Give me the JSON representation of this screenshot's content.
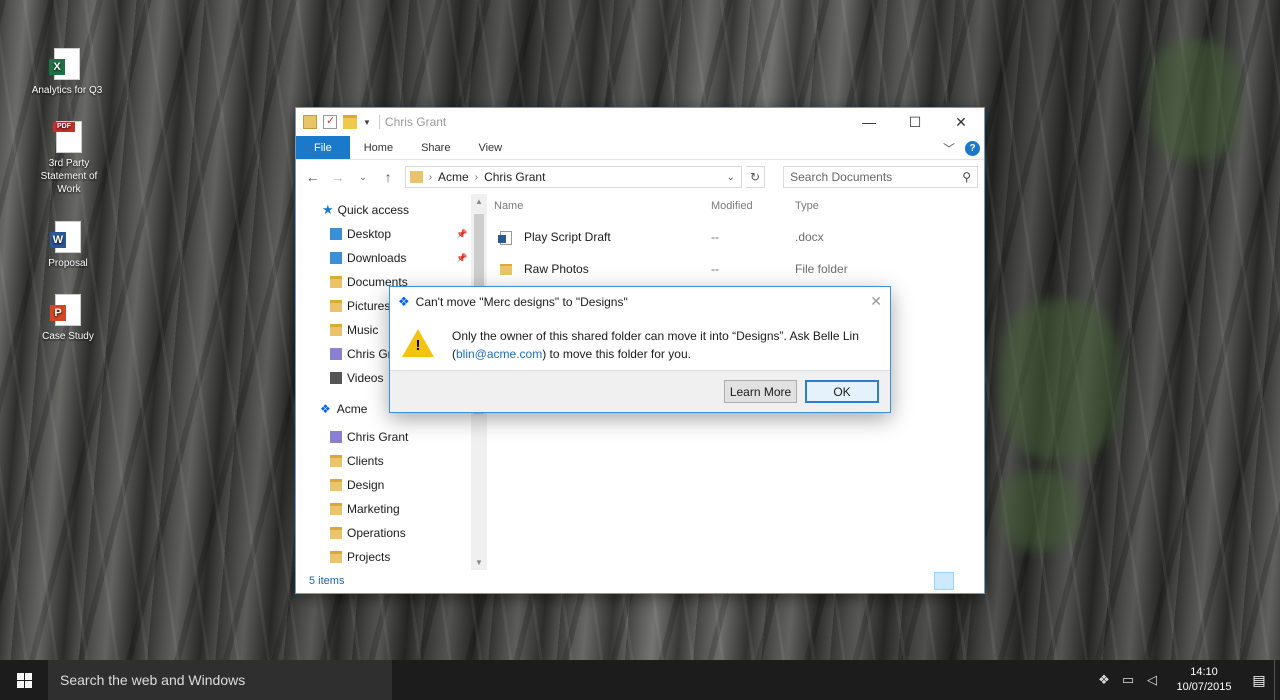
{
  "desktop": {
    "icons": [
      {
        "label": "Analytics for Q3",
        "icon": "excel-file-icon",
        "badge": "X",
        "color": "#1e7145"
      },
      {
        "label": "3rd Party Statement of Work",
        "icon": "pdf-file-icon",
        "badge": "PDF",
        "color": "#c4302b"
      },
      {
        "label": "Proposal",
        "icon": "word-file-icon",
        "badge": "W",
        "color": "#2b5797"
      },
      {
        "label": "Case Study",
        "icon": "powerpoint-file-icon",
        "badge": "P",
        "color": "#d24726"
      }
    ]
  },
  "explorer": {
    "title": "Chris Grant",
    "tabs": {
      "file": "File",
      "home": "Home",
      "share": "Share",
      "view": "View"
    },
    "help": "?",
    "breadcrumb": [
      "Acme",
      "Chris Grant"
    ],
    "search_placeholder": "Search Documents",
    "quick_access": "Quick access",
    "nav_items": [
      {
        "label": "Desktop",
        "pinned": true
      },
      {
        "label": "Downloads",
        "pinned": true
      },
      {
        "label": "Documents",
        "pinned": false
      },
      {
        "label": "Pictures",
        "pinned": false
      },
      {
        "label": "Music",
        "pinned": false
      },
      {
        "label": "Chris Grant",
        "pinned": false
      },
      {
        "label": "Videos",
        "pinned": false
      }
    ],
    "acme": "Acme",
    "acme_items": [
      "Chris Grant",
      "Clients",
      "Design",
      "Marketing",
      "Operations",
      "Projects"
    ],
    "columns": {
      "name": "Name",
      "modified": "Modified",
      "type": "Type"
    },
    "files": [
      {
        "name": "Play Script Draft",
        "modified": "--",
        "type": ".docx"
      },
      {
        "name": "Raw Photos",
        "modified": "--",
        "type": "File folder"
      }
    ],
    "status": "5 items"
  },
  "dialog": {
    "title": "Can't move \"Merc designs\" to \"Designs\"",
    "message_line1": "Only the owner of this shared folder can move it into “Designs”. Ask Belle Lin",
    "message_line2_pre": "(",
    "email": "blin@acme.com",
    "message_line2_post": ") to move this folder for you.",
    "learn_more": "Learn More",
    "ok": "OK"
  },
  "taskbar": {
    "search": "Search the web and Windows",
    "time": "14:10",
    "date": "10/07/2015"
  }
}
